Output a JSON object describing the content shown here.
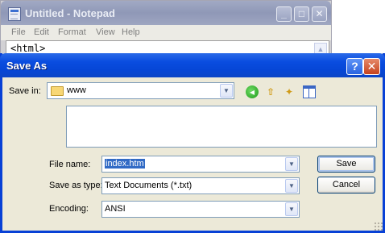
{
  "notepad": {
    "title": "Untitled - Notepad",
    "menu": [
      "File",
      "Edit",
      "Format",
      "View",
      "Help"
    ],
    "content": "<html>",
    "controls": {
      "minimize": "_",
      "maximize": "□",
      "close": "✕"
    }
  },
  "dialog": {
    "title": "Save As",
    "help_label": "?",
    "close_label": "✕",
    "save_in": {
      "label": "Save in:",
      "value": "www"
    },
    "file_name": {
      "label": "File name:",
      "value": "index.htm"
    },
    "save_as_type": {
      "label": "Save as type:",
      "value": "Text Documents (*.txt)"
    },
    "encoding": {
      "label": "Encoding:",
      "value": "ANSI"
    },
    "buttons": {
      "save": "Save",
      "cancel": "Cancel"
    },
    "toolbar_icons": [
      "back-icon",
      "up-folder-icon",
      "new-folder-icon",
      "view-menu-icon"
    ]
  },
  "colors": {
    "dialog_titlebar": "#0a4de0",
    "inactive_titlebar": "#9aa3c1",
    "face": "#ece9d8",
    "selection": "#316ac5"
  }
}
